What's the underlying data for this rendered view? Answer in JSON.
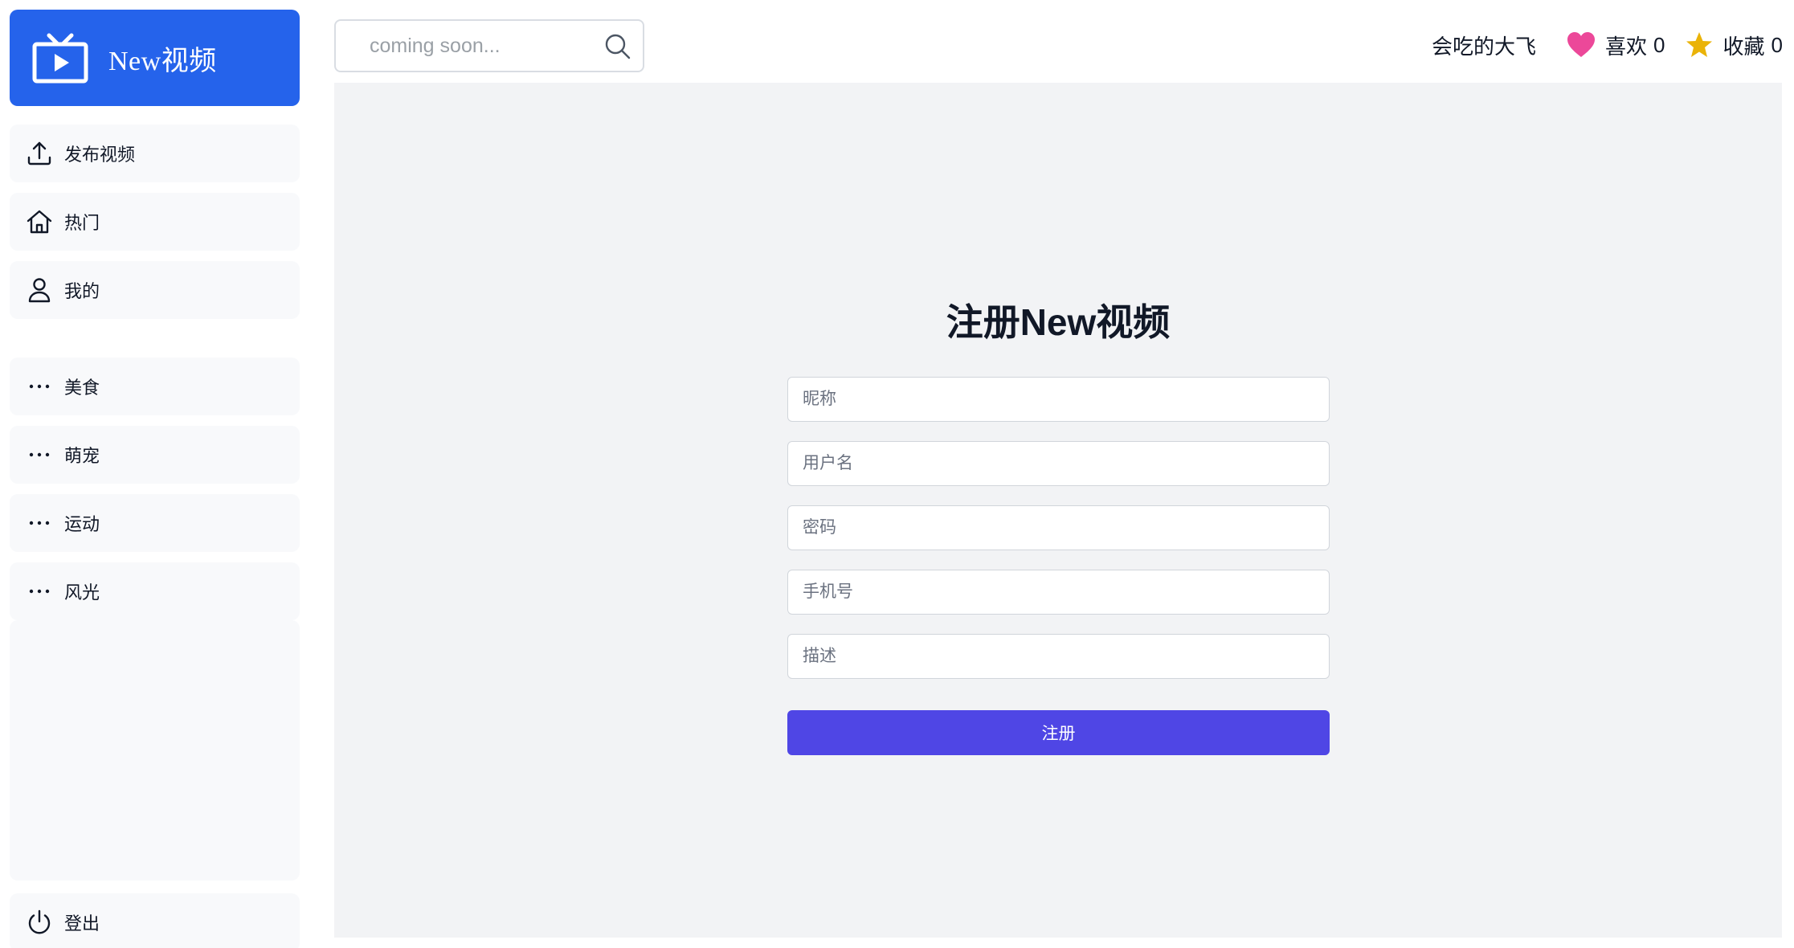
{
  "app": {
    "brand_title": "New视频",
    "brand_color": "#2563eb"
  },
  "sidebar": {
    "items": [
      {
        "label": "发布视频",
        "icon": "upload-icon"
      },
      {
        "label": "热门",
        "icon": "home-icon"
      },
      {
        "label": "我的",
        "icon": "user-icon"
      }
    ],
    "categories": [
      {
        "label": "美食",
        "icon": "more-dots-icon"
      },
      {
        "label": "萌宠",
        "icon": "more-dots-icon"
      },
      {
        "label": "运动",
        "icon": "more-dots-icon"
      },
      {
        "label": "风光",
        "icon": "more-dots-icon"
      }
    ],
    "logout_label": "登出"
  },
  "search": {
    "placeholder": "coming soon..."
  },
  "header": {
    "username": "会吃的大飞",
    "likes_label": "喜欢",
    "likes_count": "0",
    "favorites_label": "收藏",
    "favorites_count": "0",
    "heart_color": "#ec4899",
    "star_color": "#eab308"
  },
  "form": {
    "title": "注册New视频",
    "fields": {
      "nickname_placeholder": "昵称",
      "username_placeholder": "用户名",
      "password_placeholder": "密码",
      "phone_placeholder": "手机号",
      "description_placeholder": "描述"
    },
    "submit_label": "注册",
    "submit_color": "#4f46e5"
  }
}
